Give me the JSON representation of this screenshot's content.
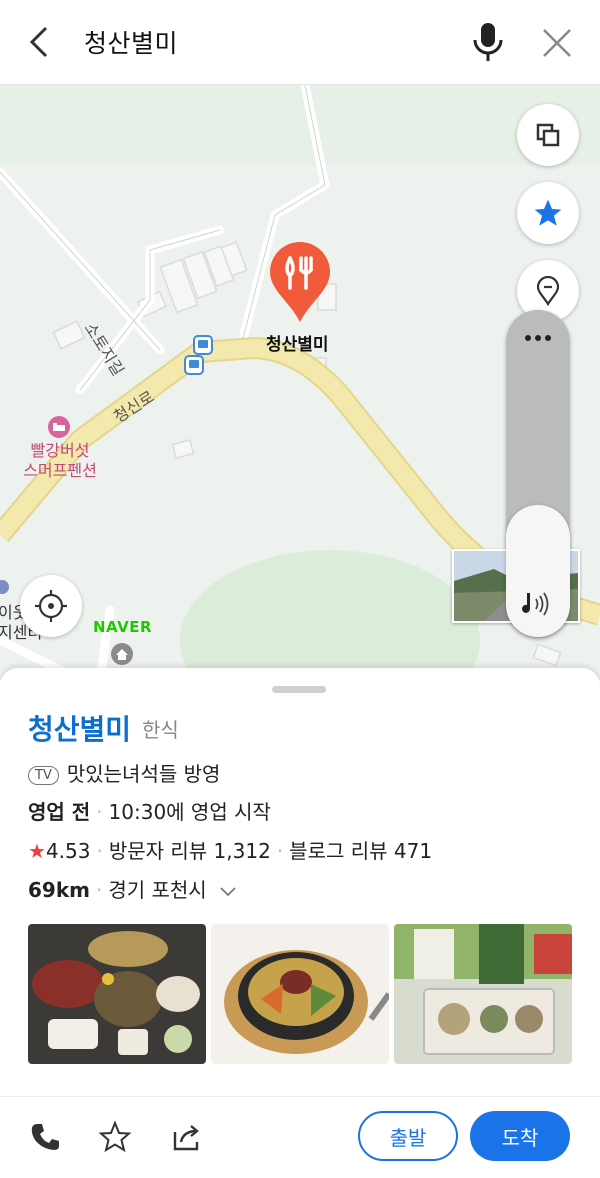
{
  "search": {
    "query": "청산별미"
  },
  "map": {
    "pin_label": "청산별미",
    "road_labels": [
      "소토지길",
      "청신로"
    ],
    "poi": {
      "line1": "빨강버섯",
      "line2": "스머프펜션"
    },
    "partial_label": {
      "line1": "이웃",
      "line2": "지센터"
    },
    "watermark": "NAVER",
    "colors": {
      "road": "#f3e9ad",
      "pin": "#f15a3a",
      "accent": "#1a73e8"
    }
  },
  "place": {
    "name": "청산별미",
    "category": "한식",
    "tv_badge": "TV",
    "tv_program": "맛있는녀석들 방영",
    "status": "영업 전",
    "hours": "10:30에 영업 시작",
    "rating_star": "★",
    "rating": "4.53",
    "visitor_reviews": "방문자 리뷰 1,312",
    "blog_reviews": "블로그 리뷰 471",
    "distance": "69km",
    "address": "경기 포천시"
  },
  "actions": {
    "depart": "출발",
    "arrive": "도착",
    "icons": [
      "phone-icon",
      "star-outline-icon",
      "share-icon"
    ]
  }
}
